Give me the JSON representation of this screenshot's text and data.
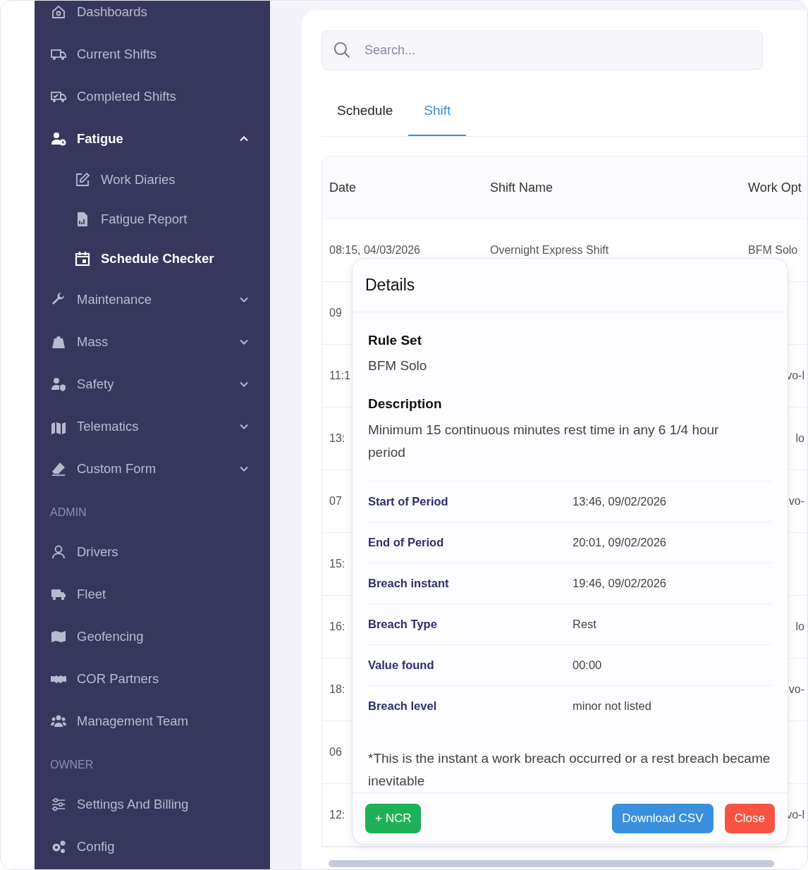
{
  "sidebar": {
    "sections": [
      {
        "items": [
          {
            "label": "Dashboards"
          },
          {
            "label": "Current Shifts"
          },
          {
            "label": "Completed Shifts"
          },
          {
            "label": "Fatigue",
            "expanded": true,
            "children": [
              {
                "label": "Work Diaries",
                "selected": false
              },
              {
                "label": "Fatigue Report",
                "selected": false
              },
              {
                "label": "Schedule Checker",
                "selected": true
              }
            ]
          },
          {
            "label": "Maintenance",
            "expanded": false
          },
          {
            "label": "Mass",
            "expanded": false
          },
          {
            "label": "Safety",
            "expanded": false
          },
          {
            "label": "Telematics",
            "expanded": false
          },
          {
            "label": "Custom Form",
            "expanded": false
          }
        ]
      },
      {
        "heading": "ADMIN",
        "items": [
          {
            "label": "Drivers"
          },
          {
            "label": "Fleet"
          },
          {
            "label": "Geofencing"
          },
          {
            "label": "COR Partners"
          },
          {
            "label": "Management Team"
          }
        ]
      },
      {
        "heading": "OWNER",
        "items": [
          {
            "label": "Settings And Billing"
          },
          {
            "label": "Config"
          }
        ]
      }
    ]
  },
  "search": {
    "placeholder": "Search..."
  },
  "tabs": [
    {
      "label": "Schedule",
      "selected": false
    },
    {
      "label": "Shift",
      "selected": true
    }
  ],
  "table": {
    "columns": [
      "Date",
      "Shift Name",
      "Work Opt"
    ],
    "rows": [
      {
        "date": "08:15, 04/03/2026",
        "shift_name": "Overnight Express Shift",
        "work_option": "BFM Solo"
      },
      {
        "date": "09"
      },
      {
        "date": "11:1",
        "work_option": "vo-l"
      },
      {
        "date": "13:",
        "work_option": "lo"
      },
      {
        "date": "07",
        "work_option": "vo-"
      },
      {
        "date": "15:"
      },
      {
        "date": "16:",
        "work_option": "lo"
      },
      {
        "date": "18:",
        "work_option": "vo-"
      },
      {
        "date": "06"
      },
      {
        "date": "12:",
        "work_option": "vo-l"
      }
    ]
  },
  "modal": {
    "title": "Details",
    "rule_set": {
      "label": "Rule Set",
      "value": "BFM Solo"
    },
    "description": {
      "label": "Description",
      "value": "Minimum 15 continuous minutes rest time in any 6 1/4 hour period"
    },
    "rows": [
      {
        "label": "Start of Period",
        "value": "13:46, 09/02/2026"
      },
      {
        "label": "End of Period",
        "value": "20:01, 09/02/2026"
      },
      {
        "label": "Breach instant",
        "value": "19:46, 09/02/2026"
      },
      {
        "label": "Breach Type",
        "value": "Rest"
      },
      {
        "label": "Value found",
        "value": "00:00"
      },
      {
        "label": "Breach level",
        "value": "minor not listed"
      }
    ],
    "footnote": "*This is the instant a work breach occurred or a rest breach became inevitable",
    "buttons": [
      {
        "label": "+ NCR",
        "kind": "success"
      },
      {
        "label": "Download CSV",
        "kind": "primary"
      },
      {
        "label": "Close",
        "kind": "danger"
      }
    ]
  }
}
